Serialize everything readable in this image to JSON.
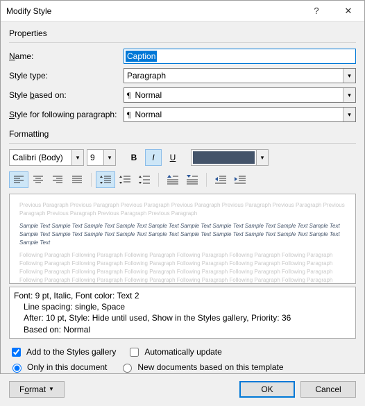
{
  "title": "Modify Style",
  "sections": {
    "properties": "Properties",
    "formatting": "Formatting"
  },
  "props": {
    "name_label": "Name:",
    "name_value": "Caption",
    "type_label": "Style type:",
    "type_value": "Paragraph",
    "based_label_pre": "Style ",
    "based_label_ul": "b",
    "based_label_post": "ased on:",
    "based_value": "Normal",
    "follow_label_pre": "",
    "follow_label_ul": "S",
    "follow_label_post": "tyle for following paragraph:",
    "follow_value": "Normal"
  },
  "font": {
    "name": "Calibri (Body)",
    "size": "9",
    "bold": false,
    "italic": true,
    "underline": false,
    "color": "#44546a"
  },
  "preview": {
    "prev_para": "Previous Paragraph Previous Paragraph Previous Paragraph Previous Paragraph Previous Paragraph Previous Paragraph Previous Paragraph Previous Paragraph Previous Paragraph Previous Paragraph",
    "sample": "Sample Text Sample Text Sample Text Sample Text Sample Text Sample Text Sample Text Sample Text Sample Text Sample Text Sample Text Sample Text Sample Text Sample Text Sample Text Sample Text Sample Text Sample Text Sample Text Sample Text Sample Text",
    "follow_para": "Following Paragraph Following Paragraph Following Paragraph Following Paragraph Following Paragraph Following Paragraph Following Paragraph Following Paragraph Following Paragraph Following Paragraph Following Paragraph Following Paragraph Following Paragraph Following Paragraph Following Paragraph Following Paragraph Following Paragraph Following Paragraph Following Paragraph Following Paragraph Following Paragraph Following Paragraph Following Paragraph Following Paragraph Following Paragraph"
  },
  "desc": {
    "line1": "Font: 9 pt, Italic, Font color: Text 2",
    "line2": "Line spacing:  single, Space",
    "line3": "After:  10 pt, Style: Hide until used, Show in the Styles gallery, Priority: 36",
    "line4": "Based on: Normal"
  },
  "checks": {
    "gallery": "Add to the Styles gallery",
    "auto": "Automatically update",
    "gallery_checked": true,
    "auto_checked": false
  },
  "radios": {
    "doc": "Only in this document",
    "template": "New documents based on this template",
    "selected": "doc"
  },
  "buttons": {
    "format": "Format",
    "ok": "OK",
    "cancel": "Cancel",
    "help": "?",
    "close": "✕"
  }
}
